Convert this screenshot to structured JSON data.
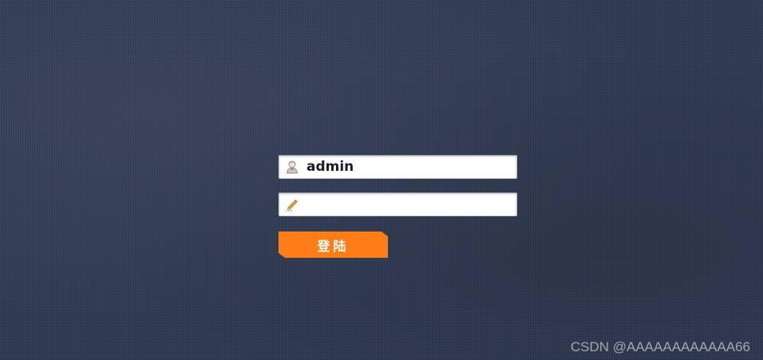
{
  "login": {
    "username_value": "admin",
    "password_value": "",
    "submit_label": "登陆"
  },
  "icons": {
    "username": "user-avatar-icon",
    "password": "pencil-icon"
  },
  "colors": {
    "background": "#2f3a52",
    "button": "#fd7e17",
    "button_text": "#ffffff"
  },
  "watermark": "CSDN @AAAAAAAAAAAA66"
}
